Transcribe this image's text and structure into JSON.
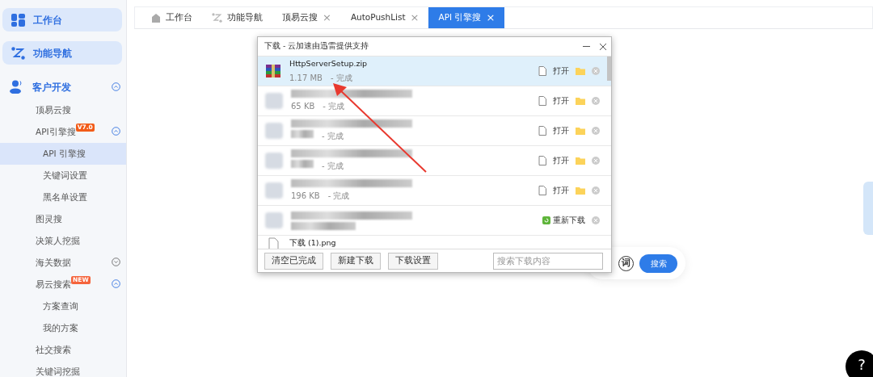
{
  "sidebar": {
    "cards": [
      {
        "label": "工作台"
      },
      {
        "label": "功能导航"
      }
    ],
    "section": {
      "label": "客户开发",
      "expanded": true,
      "items": [
        {
          "label": "顶易云搜",
          "selected": false
        },
        {
          "label": "API引擎搜",
          "badge": "V7.0",
          "expanded": true,
          "selected": false,
          "children": [
            {
              "label": "API 引擎搜",
              "selected": true
            },
            {
              "label": "关键词设置",
              "selected": false
            },
            {
              "label": "黑名单设置",
              "selected": false
            }
          ]
        },
        {
          "label": "图灵搜",
          "selected": false
        },
        {
          "label": "决策人挖掘",
          "selected": false
        },
        {
          "label": "海关数据",
          "expanded": false,
          "selected": false
        },
        {
          "label": "易云搜索",
          "badge": "NEW",
          "expanded": true,
          "selected": false,
          "children": [
            {
              "label": "方案查询",
              "selected": false
            },
            {
              "label": "我的方案",
              "selected": false
            }
          ]
        },
        {
          "label": "社交搜索",
          "selected": false
        },
        {
          "label": "关键词挖掘",
          "selected": false
        }
      ]
    }
  },
  "tabs": [
    {
      "kind": "home",
      "label": "工作台",
      "selected": false
    },
    {
      "kind": "route",
      "label": "功能导航",
      "selected": false
    },
    {
      "kind": "plain",
      "label": "顶易云搜",
      "close": "×",
      "selected": false
    },
    {
      "kind": "plain",
      "label": "AutoPushList",
      "close": "×",
      "selected": false
    },
    {
      "kind": "plain",
      "label": "API 引擎搜",
      "close": "×",
      "selected": true
    }
  ],
  "download_dialog": {
    "title": "下载 - 云加速由迅雷提供支持",
    "rows": [
      {
        "kind": "done",
        "name": "HttpServerSetup.zip",
        "size": "1.17 MB",
        "status": "- 完成",
        "action": "打开",
        "selected": true
      },
      {
        "kind": "done",
        "size": "65 KB",
        "status": "- 完成",
        "action": "打开",
        "selected": false
      },
      {
        "kind": "done",
        "status": "- 完成",
        "action": "打开",
        "selected": false
      },
      {
        "kind": "done",
        "status": "- 完成",
        "action": "打开",
        "selected": false
      },
      {
        "kind": "done",
        "size": "196 KB",
        "status": "- 完成",
        "action": "打开",
        "selected": false
      },
      {
        "kind": "failed",
        "action": "重新下载",
        "selected": false
      },
      {
        "kind": "partial",
        "name": "下载 (1).png",
        "selected": false
      }
    ],
    "buttons": [
      "清空已完成",
      "新建下载",
      "下载设置"
    ],
    "search": {
      "placeholder": "搜索下载内容"
    }
  },
  "search_bar": {
    "word_toggle": "词",
    "button": "搜索"
  },
  "help_button": "?"
}
